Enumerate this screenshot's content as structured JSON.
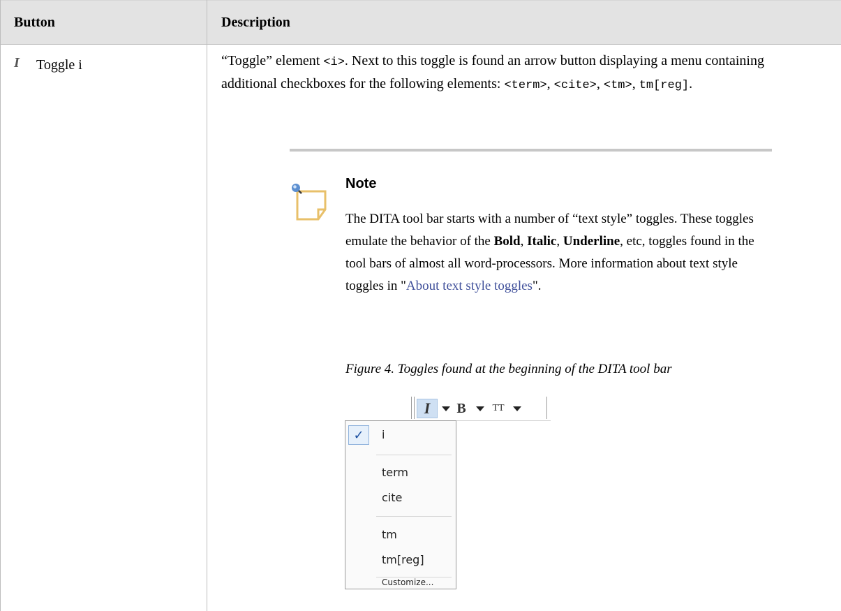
{
  "table": {
    "headers": {
      "button": "Button",
      "description": "Description"
    }
  },
  "row": {
    "button_label": "Toggle i",
    "button_icon": "italic-i-icon",
    "desc": {
      "p1": "“Toggle” element ",
      "code_i": "<i>",
      "p2": ". Next to this toggle is found an arrow button displaying a menu containing additional checkboxes for the following elements: ",
      "code_term": "<term>",
      "comma1": ", ",
      "code_cite": "<cite>",
      "comma2": ", ",
      "code_tm": "<tm>",
      "comma3": ", ",
      "code_tmreg": "tm[reg]",
      "end": "."
    }
  },
  "note": {
    "title": "Note",
    "icon": "note-icon",
    "t1": "The DITA tool bar starts with a number of “text style” toggles. These toggles emulate the behavior of the ",
    "bold": "Bold",
    "sep1": ", ",
    "italic": "Italic",
    "sep2": ", ",
    "underline": "Underline",
    "t2": ", etc, toggles found in the tool bars of almost all word-processors. More information about text style toggles in \"",
    "link": "About text style toggles",
    "t3": "\"."
  },
  "figure": {
    "caption": "Figure 4. Toggles found at the beginning of the DITA tool bar",
    "toolbar": {
      "italic": "I",
      "bold": "B",
      "tt": "TT"
    },
    "menu": {
      "check": "✓",
      "items": [
        "i",
        "term",
        "cite",
        "tm",
        "tm[reg]",
        "Customize..."
      ]
    }
  },
  "colors": {
    "header_bg": "#e3e3e3",
    "link": "#3f4f9a",
    "note_icon": "#e8c06a",
    "active": "#cfe0f3"
  }
}
